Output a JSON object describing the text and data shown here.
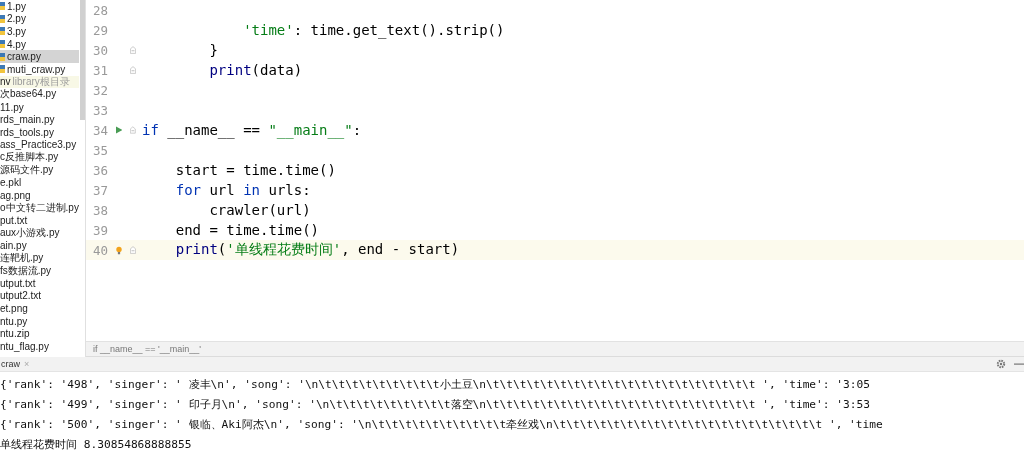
{
  "sidebar": {
    "items": [
      {
        "label": "1.py",
        "kind": "python",
        "selected": false
      },
      {
        "label": "2.py",
        "kind": "python",
        "selected": false
      },
      {
        "label": "3.py",
        "kind": "python",
        "selected": false
      },
      {
        "label": "4.py",
        "kind": "python",
        "selected": false
      },
      {
        "label": "craw.py",
        "kind": "python",
        "selected": true
      },
      {
        "label": "muti_craw.py",
        "kind": "python",
        "selected": false
      },
      {
        "label": "nv",
        "note": "library根目录",
        "kind": "library",
        "selected": false
      },
      {
        "label": "次base64.py",
        "kind": "file",
        "selected": false
      },
      {
        "label": "11.py",
        "kind": "file",
        "selected": false
      },
      {
        "label": "rds_main.py",
        "kind": "file",
        "selected": false
      },
      {
        "label": "rds_tools.py",
        "kind": "file",
        "selected": false
      },
      {
        "label": "ass_Practice3.py",
        "kind": "file",
        "selected": false
      },
      {
        "label": "c反推脚本.py",
        "kind": "file",
        "selected": false
      },
      {
        "label": "源码文件.py",
        "kind": "file",
        "selected": false
      },
      {
        "label": "e.pkl",
        "kind": "file",
        "selected": false
      },
      {
        "label": "ag.png",
        "kind": "file",
        "selected": false
      },
      {
        "label": "o中文转二进制.py",
        "kind": "file",
        "selected": false
      },
      {
        "label": "put.txt",
        "kind": "file",
        "selected": false
      },
      {
        "label": "aux小游戏.py",
        "kind": "file",
        "selected": false
      },
      {
        "label": "ain.py",
        "kind": "file",
        "selected": false
      },
      {
        "label": "连靶机.py",
        "kind": "file",
        "selected": false
      },
      {
        "label": "fs数据流.py",
        "kind": "file",
        "selected": false
      },
      {
        "label": "utput.txt",
        "kind": "file",
        "selected": false
      },
      {
        "label": "utput2.txt",
        "kind": "file",
        "selected": false
      },
      {
        "label": "et.png",
        "kind": "file",
        "selected": false
      },
      {
        "label": "ntu.py",
        "kind": "file",
        "selected": false
      },
      {
        "label": "ntu.zip",
        "kind": "file",
        "selected": false
      },
      {
        "label": "ntu_flag.py",
        "kind": "file",
        "selected": false
      }
    ]
  },
  "editor": {
    "lines": [
      {
        "number": "28",
        "current": false
      },
      {
        "number": "29",
        "current": false,
        "tokens": [
          {
            "kind": "string",
            "text": "            'time'"
          },
          {
            "kind": "plain",
            "text": ": time.get_text().strip()"
          }
        ]
      },
      {
        "number": "30",
        "current": false,
        "fold": true,
        "tokens": [
          {
            "kind": "plain",
            "text": "        }"
          }
        ]
      },
      {
        "number": "31",
        "current": false,
        "fold": true,
        "tokens": [
          {
            "kind": "builtin",
            "text": "        print"
          },
          {
            "kind": "plain",
            "text": "(data)"
          }
        ]
      },
      {
        "number": "32",
        "current": false
      },
      {
        "number": "33",
        "current": false
      },
      {
        "number": "34",
        "current": false,
        "run": true,
        "fold": true,
        "tokens": [
          {
            "kind": "keyword",
            "text": "if"
          },
          {
            "kind": "plain",
            "text": " __name__ == "
          },
          {
            "kind": "string",
            "text": "\"__main__\""
          },
          {
            "kind": "plain",
            "text": ":"
          }
        ]
      },
      {
        "number": "35",
        "current": false
      },
      {
        "number": "36",
        "current": false,
        "tokens": [
          {
            "kind": "plain",
            "text": "    start = time.time()"
          }
        ]
      },
      {
        "number": "37",
        "current": false,
        "tokens": [
          {
            "kind": "keyword",
            "text": "    for"
          },
          {
            "kind": "plain",
            "text": " url "
          },
          {
            "kind": "keyword",
            "text": "in"
          },
          {
            "kind": "plain",
            "text": " urls:"
          }
        ]
      },
      {
        "number": "38",
        "current": false,
        "tokens": [
          {
            "kind": "plain",
            "text": "        crawler(url)"
          }
        ]
      },
      {
        "number": "39",
        "current": false,
        "tokens": [
          {
            "kind": "plain",
            "text": "    end = time.time()"
          }
        ]
      },
      {
        "number": "40",
        "current": true,
        "bulb": true,
        "fold": true,
        "tokens": [
          {
            "kind": "builtin",
            "text": "    print"
          },
          {
            "kind": "plain",
            "text": "("
          },
          {
            "kind": "string",
            "text": "'单线程花费时间'"
          },
          {
            "kind": "plain",
            "text": ", end - start)"
          }
        ]
      }
    ],
    "breadcrumb": "if __name__ == '__main__'"
  },
  "console": {
    "tab": "craw",
    "close": "×",
    "lines": [
      "{'rank': '498', 'singer': ' 凌丰\\n', 'song': '\\n\\t\\t\\t\\t\\t\\t\\t\\t\\t小土豆\\n\\t\\t\\t\\t\\t\\t\\t\\t\\t\\t\\t\\t\\t\\t\\t\\t\\t\\t\\t\\t ', 'time': '3:05",
      "{'rank': '499', 'singer': ' 印子月\\n', 'song': '\\n\\t\\t\\t\\t\\t\\t\\t\\t\\t落空\\n\\t\\t\\t\\t\\t\\t\\t\\t\\t\\t\\t\\t\\t\\t\\t\\t\\t\\t\\t\\t ', 'time': '3:53",
      "{'rank': '500', 'singer': ' 银临、Aki阿杰\\n', 'song': '\\n\\t\\t\\t\\t\\t\\t\\t\\t\\t\\t牵丝戏\\n\\t\\t\\t\\t\\t\\t\\t\\t\\t\\t\\t\\t\\t\\t\\t\\t\\t\\t\\t\\t ', 'time",
      "单线程花费时间 8.30854868888855"
    ]
  }
}
